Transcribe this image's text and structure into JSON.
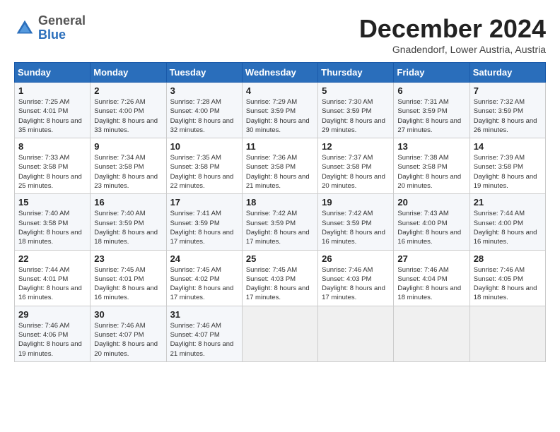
{
  "header": {
    "logo": {
      "general": "General",
      "blue": "Blue"
    },
    "title": "December 2024",
    "subtitle": "Gnadendorf, Lower Austria, Austria"
  },
  "weekdays": [
    "Sunday",
    "Monday",
    "Tuesday",
    "Wednesday",
    "Thursday",
    "Friday",
    "Saturday"
  ],
  "weeks": [
    [
      {
        "day": "1",
        "sunrise": "7:25 AM",
        "sunset": "4:01 PM",
        "daylight": "8 hours and 35 minutes."
      },
      {
        "day": "2",
        "sunrise": "7:26 AM",
        "sunset": "4:00 PM",
        "daylight": "8 hours and 33 minutes."
      },
      {
        "day": "3",
        "sunrise": "7:28 AM",
        "sunset": "4:00 PM",
        "daylight": "8 hours and 32 minutes."
      },
      {
        "day": "4",
        "sunrise": "7:29 AM",
        "sunset": "3:59 PM",
        "daylight": "8 hours and 30 minutes."
      },
      {
        "day": "5",
        "sunrise": "7:30 AM",
        "sunset": "3:59 PM",
        "daylight": "8 hours and 29 minutes."
      },
      {
        "day": "6",
        "sunrise": "7:31 AM",
        "sunset": "3:59 PM",
        "daylight": "8 hours and 27 minutes."
      },
      {
        "day": "7",
        "sunrise": "7:32 AM",
        "sunset": "3:59 PM",
        "daylight": "8 hours and 26 minutes."
      }
    ],
    [
      {
        "day": "8",
        "sunrise": "7:33 AM",
        "sunset": "3:58 PM",
        "daylight": "8 hours and 25 minutes."
      },
      {
        "day": "9",
        "sunrise": "7:34 AM",
        "sunset": "3:58 PM",
        "daylight": "8 hours and 23 minutes."
      },
      {
        "day": "10",
        "sunrise": "7:35 AM",
        "sunset": "3:58 PM",
        "daylight": "8 hours and 22 minutes."
      },
      {
        "day": "11",
        "sunrise": "7:36 AM",
        "sunset": "3:58 PM",
        "daylight": "8 hours and 21 minutes."
      },
      {
        "day": "12",
        "sunrise": "7:37 AM",
        "sunset": "3:58 PM",
        "daylight": "8 hours and 20 minutes."
      },
      {
        "day": "13",
        "sunrise": "7:38 AM",
        "sunset": "3:58 PM",
        "daylight": "8 hours and 20 minutes."
      },
      {
        "day": "14",
        "sunrise": "7:39 AM",
        "sunset": "3:58 PM",
        "daylight": "8 hours and 19 minutes."
      }
    ],
    [
      {
        "day": "15",
        "sunrise": "7:40 AM",
        "sunset": "3:58 PM",
        "daylight": "8 hours and 18 minutes."
      },
      {
        "day": "16",
        "sunrise": "7:40 AM",
        "sunset": "3:59 PM",
        "daylight": "8 hours and 18 minutes."
      },
      {
        "day": "17",
        "sunrise": "7:41 AM",
        "sunset": "3:59 PM",
        "daylight": "8 hours and 17 minutes."
      },
      {
        "day": "18",
        "sunrise": "7:42 AM",
        "sunset": "3:59 PM",
        "daylight": "8 hours and 17 minutes."
      },
      {
        "day": "19",
        "sunrise": "7:42 AM",
        "sunset": "3:59 PM",
        "daylight": "8 hours and 16 minutes."
      },
      {
        "day": "20",
        "sunrise": "7:43 AM",
        "sunset": "4:00 PM",
        "daylight": "8 hours and 16 minutes."
      },
      {
        "day": "21",
        "sunrise": "7:44 AM",
        "sunset": "4:00 PM",
        "daylight": "8 hours and 16 minutes."
      }
    ],
    [
      {
        "day": "22",
        "sunrise": "7:44 AM",
        "sunset": "4:01 PM",
        "daylight": "8 hours and 16 minutes."
      },
      {
        "day": "23",
        "sunrise": "7:45 AM",
        "sunset": "4:01 PM",
        "daylight": "8 hours and 16 minutes."
      },
      {
        "day": "24",
        "sunrise": "7:45 AM",
        "sunset": "4:02 PM",
        "daylight": "8 hours and 17 minutes."
      },
      {
        "day": "25",
        "sunrise": "7:45 AM",
        "sunset": "4:03 PM",
        "daylight": "8 hours and 17 minutes."
      },
      {
        "day": "26",
        "sunrise": "7:46 AM",
        "sunset": "4:03 PM",
        "daylight": "8 hours and 17 minutes."
      },
      {
        "day": "27",
        "sunrise": "7:46 AM",
        "sunset": "4:04 PM",
        "daylight": "8 hours and 18 minutes."
      },
      {
        "day": "28",
        "sunrise": "7:46 AM",
        "sunset": "4:05 PM",
        "daylight": "8 hours and 18 minutes."
      }
    ],
    [
      {
        "day": "29",
        "sunrise": "7:46 AM",
        "sunset": "4:06 PM",
        "daylight": "8 hours and 19 minutes."
      },
      {
        "day": "30",
        "sunrise": "7:46 AM",
        "sunset": "4:07 PM",
        "daylight": "8 hours and 20 minutes."
      },
      {
        "day": "31",
        "sunrise": "7:46 AM",
        "sunset": "4:07 PM",
        "daylight": "8 hours and 21 minutes."
      },
      null,
      null,
      null,
      null
    ]
  ]
}
